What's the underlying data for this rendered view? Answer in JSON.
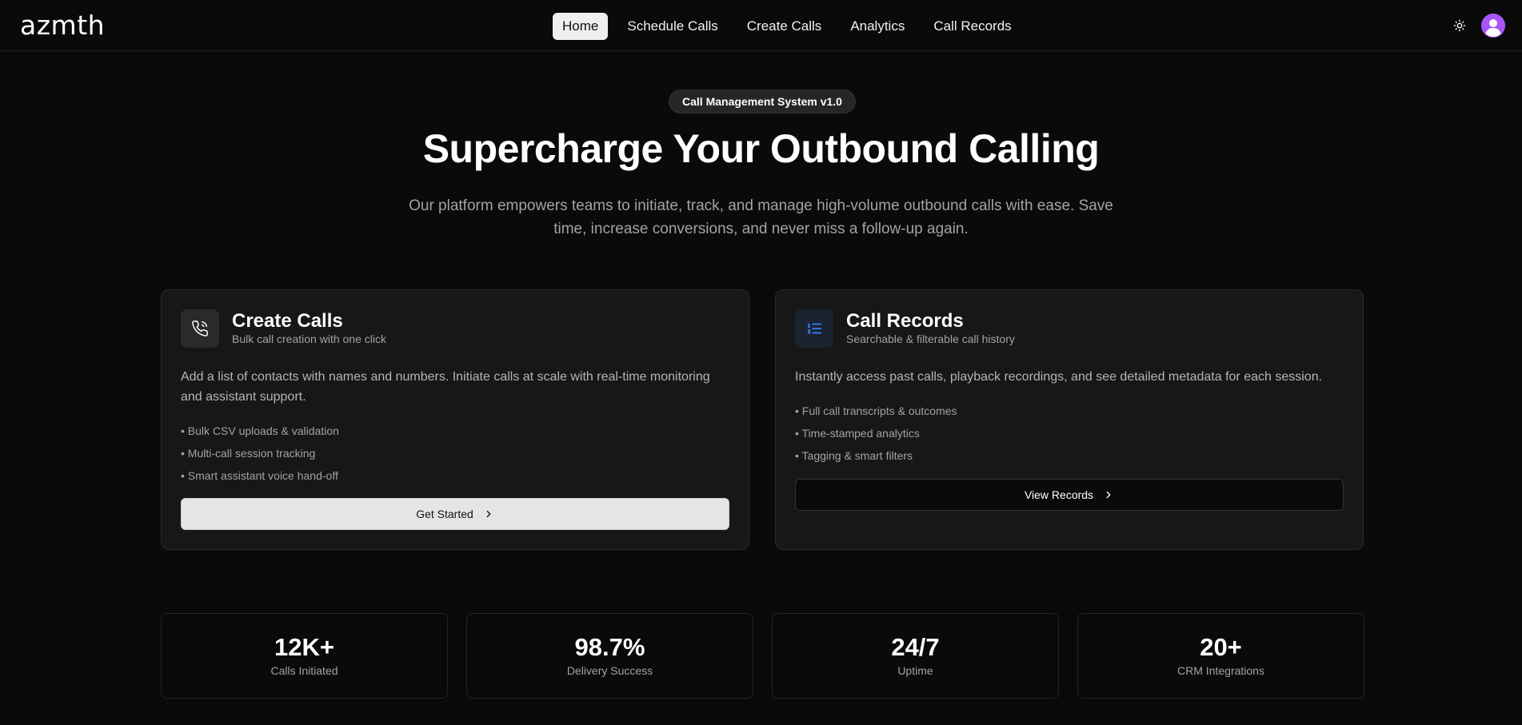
{
  "header": {
    "logo": "azmth",
    "nav": [
      {
        "label": "Home",
        "active": true
      },
      {
        "label": "Schedule Calls",
        "active": false
      },
      {
        "label": "Create Calls",
        "active": false
      },
      {
        "label": "Analytics",
        "active": false
      },
      {
        "label": "Call Records",
        "active": false
      }
    ],
    "theme_icon": "sun-icon",
    "avatar_icon": "user-avatar-icon",
    "avatar_color": "#a855f7"
  },
  "hero": {
    "badge": "Call Management System v1.0",
    "title": "Supercharge Your Outbound Calling",
    "subtitle": "Our platform empowers teams to initiate, track, and manage high-volume outbound calls with ease. Save time, increase conversions, and never miss a follow-up again."
  },
  "cards": [
    {
      "icon": "phone-icon",
      "title": "Create Calls",
      "subtitle": "Bulk call creation with one click",
      "description": "Add a list of contacts with names and numbers. Initiate calls at scale with real-time monitoring and assistant support.",
      "features": [
        "• Bulk CSV uploads & validation",
        "• Multi-call session tracking",
        "• Smart assistant voice hand-off"
      ],
      "button": "Get Started"
    },
    {
      "icon": "list-ordered-icon",
      "title": "Call Records",
      "subtitle": "Searchable & filterable call history",
      "description": "Instantly access past calls, playback recordings, and see detailed metadata for each session.",
      "features": [
        "• Full call transcripts & outcomes",
        "• Time-stamped analytics",
        "• Tagging & smart filters"
      ],
      "button": "View Records"
    }
  ],
  "stats": [
    {
      "value": "12K+",
      "label": "Calls Initiated"
    },
    {
      "value": "98.7%",
      "label": "Delivery Success"
    },
    {
      "value": "24/7",
      "label": "Uptime"
    },
    {
      "value": "20+",
      "label": "CRM Integrations"
    }
  ],
  "colors": {
    "background": "#0a0a0a",
    "card": "#171717",
    "accent_icon": "#3b82f6"
  }
}
